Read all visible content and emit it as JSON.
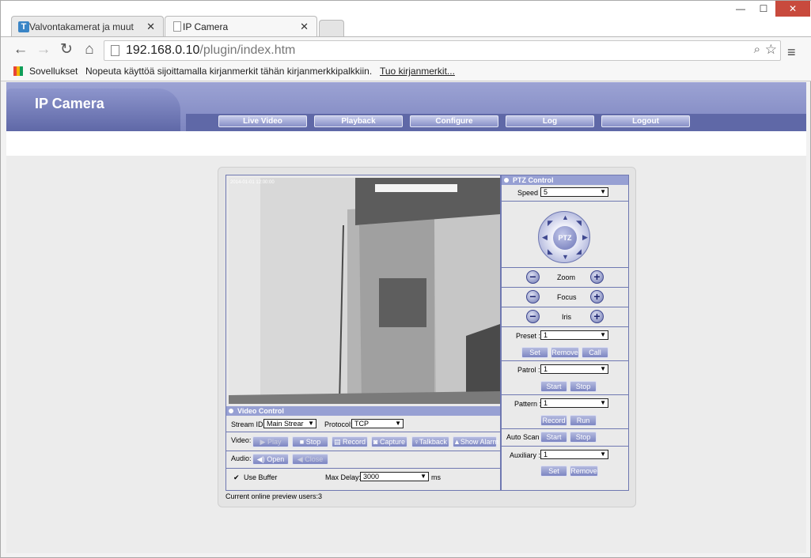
{
  "browser": {
    "tabs": [
      {
        "label": "Valvontakamerat ja muut",
        "icon": "T"
      },
      {
        "label": "IP Camera"
      }
    ],
    "window_controls": {
      "minimize": "—",
      "maximize": "☐",
      "close": "✕"
    },
    "url_host": "192.168.0.10",
    "url_path": "/plugin/index.htm",
    "bookmarks": {
      "apps": "Sovellukset",
      "hint": "Nopeuta käyttöä sijoittamalla kirjanmerkit tähän kirjanmerkkipalkkiin.",
      "import_link": "Tuo kirjanmerkit..."
    }
  },
  "app": {
    "logo": "IP Camera",
    "nav": [
      "Live Video",
      "Playback",
      "Configure",
      "Log",
      "Logout"
    ]
  },
  "video": {
    "overlay_timestamp": "2014-01-01 12:00:00",
    "section_title": "Video Control",
    "stream_id_label": "Stream ID:",
    "stream_id_value": "Main Strear",
    "protocol_label": "Protocol:",
    "protocol_value": "TCP",
    "video_label": "Video:",
    "video_buttons": [
      "Play",
      "Stop",
      "Record",
      "Capture",
      "Talkback",
      "Show Alarm"
    ],
    "audio_label": "Audio:",
    "audio_buttons": [
      "Open",
      "Close"
    ],
    "use_buffer_label": "Use Buffer",
    "use_buffer_checked": true,
    "max_delay_label": "Max Delay:",
    "max_delay_value": "3000",
    "max_delay_unit": "ms",
    "status": "Current online preview users:3"
  },
  "ptz": {
    "title": "PTZ Control",
    "speed_label": "Speed :",
    "speed_value": "5",
    "dial_label": "PTZ",
    "zoom_label": "Zoom",
    "focus_label": "Focus",
    "iris_label": "Iris",
    "preset_label": "Preset :",
    "preset_value": "1",
    "preset_buttons": [
      "Set",
      "Remove",
      "Call"
    ],
    "patrol_label": "Patrol :",
    "patrol_value": "1",
    "patrol_buttons": [
      "Start",
      "Stop"
    ],
    "pattern_label": "Pattern :",
    "pattern_value": "1",
    "pattern_buttons": [
      "Record",
      "Run"
    ],
    "autoscan_label": "Auto Scan :",
    "autoscan_buttons": [
      "Start",
      "Stop"
    ],
    "auxiliary_label": "Auxiliary :",
    "auxiliary_value": "1",
    "auxiliary_buttons": [
      "Set",
      "Remove"
    ]
  }
}
